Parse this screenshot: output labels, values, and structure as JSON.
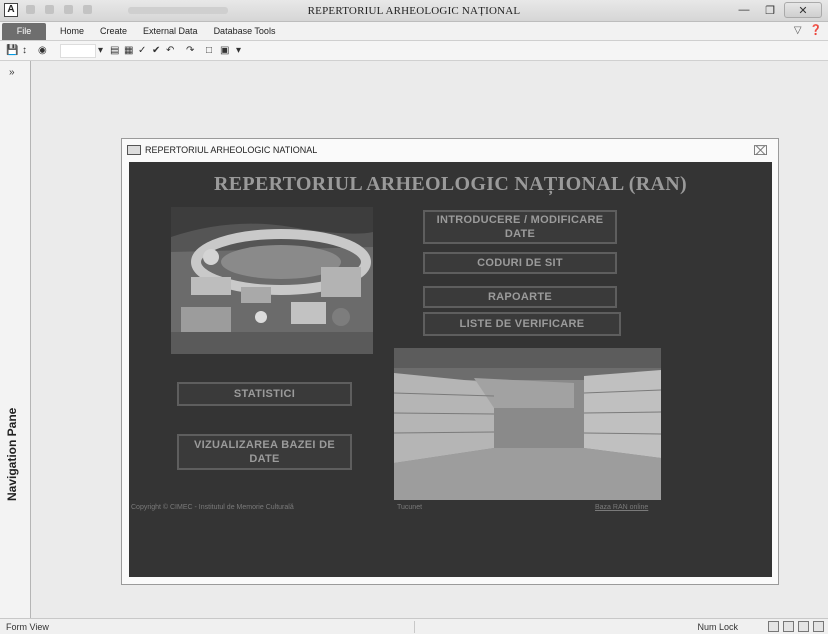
{
  "app": {
    "title": "REPERTORIUL ARHEOLOGIC NAȚIONAL",
    "icon_letter": "A"
  },
  "ribbon": {
    "file_tab": "File",
    "tabs": [
      "Home",
      "Create",
      "External Data",
      "Database Tools"
    ]
  },
  "nav_pane": {
    "label": "Navigation Pane",
    "toggle": "»"
  },
  "form": {
    "window_title": "REPERTORIUL ARHEOLOGIC NATIONAL",
    "heading": "REPERTORIUL ARHEOLOGIC NAȚIONAL (RAN)",
    "buttons": {
      "introducere": "INTRODUCERE / MODIFICARE DATE",
      "coduri": "CODURI DE SIT",
      "rapoarte": "RAPOARTE",
      "liste": "LISTE DE VERIFICARE",
      "statistici": "STATISTICI",
      "vizualizarea": "VIZUALIZAREA BAZEI DE DATE"
    },
    "footer": {
      "copyright": "Copyright © CIMEC - Institutul de Memorie Culturală",
      "middle": "Tucunet",
      "link": "Baza RAN online"
    }
  },
  "statusbar": {
    "left": "Form View",
    "right": "Num Lock"
  },
  "colors": {
    "form_background": "#343434",
    "button_text": "#9b9b9b",
    "heading_text": "#9a9a9a"
  }
}
